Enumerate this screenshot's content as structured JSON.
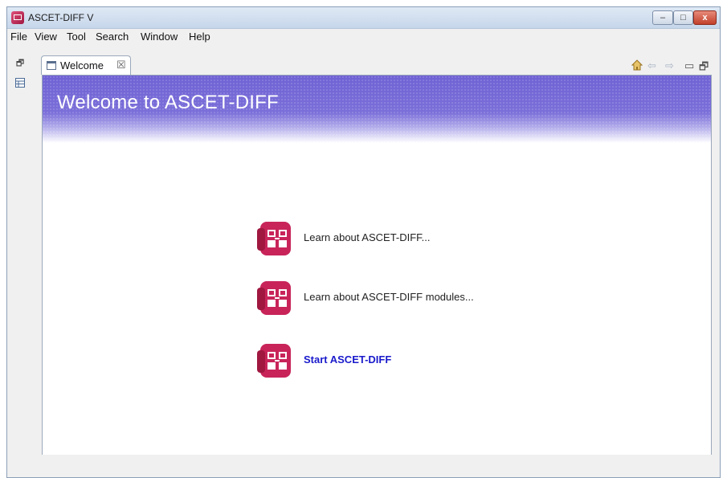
{
  "window": {
    "title": "ASCET-DIFF V",
    "controls": {
      "minimize": "–",
      "maximize": "□",
      "close": "x"
    }
  },
  "menu": [
    "File",
    "View",
    "Tool",
    "Search",
    "Window",
    "Help"
  ],
  "sidebar": {
    "icons": [
      "restore-icon",
      "table-view-icon"
    ]
  },
  "tab": {
    "label": "Welcome",
    "close": "☒"
  },
  "nav": {
    "home": "home-icon",
    "back": "back-arrow-icon",
    "forward": "forward-arrow-icon",
    "minimize": "minimize-view-icon",
    "restore": "restore-view-icon"
  },
  "welcome": {
    "title": "Welcome to ASCET-DIFF",
    "items": [
      {
        "label": "Learn about ASCET-DIFF..."
      },
      {
        "label": "Learn about ASCET-DIFF modules..."
      },
      {
        "label": "Start ASCET-DIFF"
      }
    ]
  },
  "colors": {
    "banner": "#7b6fd9",
    "icon_primary": "#c8245a",
    "link": "#1a1acc"
  }
}
